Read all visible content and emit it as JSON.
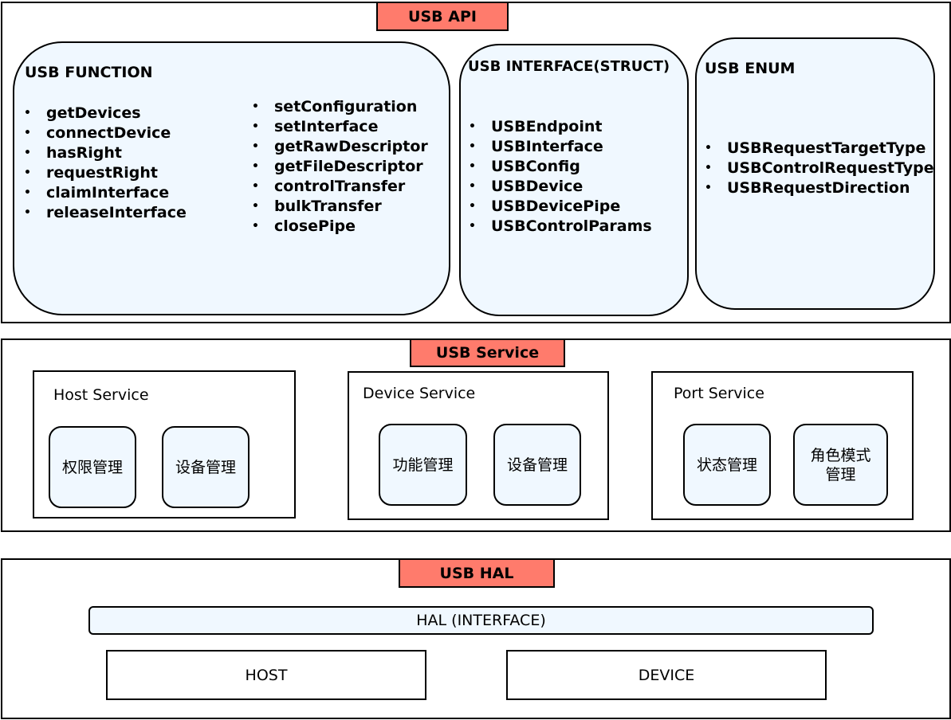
{
  "api": {
    "label": "USB API",
    "function": {
      "title": "USB FUNCTION",
      "col1": [
        "getDevices",
        "connectDevice",
        "hasRight",
        "requestRight",
        "claimInterface",
        "releaseInterface"
      ],
      "col2": [
        "setConfiguration",
        "setInterface",
        "getRawDescriptor",
        "getFileDescriptor",
        "controlTransfer",
        "bulkTransfer",
        "closePipe"
      ]
    },
    "interface": {
      "title": "USB INTERFACE(STRUCT)",
      "items": [
        "USBEndpoint",
        "USBInterface",
        "USBConfig",
        "USBDevice",
        "USBDevicePipe",
        "USBControlParams"
      ]
    },
    "enum": {
      "title": "USB ENUM",
      "items": [
        "USBRequestTargetType",
        "USBControlRequestType",
        "USBRequestDirection"
      ]
    }
  },
  "service": {
    "label": "USB Service",
    "host": {
      "title": "Host Service",
      "items": [
        "权限管理",
        "设备管理"
      ]
    },
    "device": {
      "title": "Device Service",
      "items": [
        "功能管理",
        "设备管理"
      ]
    },
    "port": {
      "title": "Port Service",
      "items": [
        "状态管理",
        "角色模式\n管理"
      ]
    }
  },
  "hal": {
    "label": "USB HAL",
    "interface": "HAL (INTERFACE)",
    "host": "HOST",
    "device": "DEVICE"
  },
  "colors": {
    "tag": "#FF7B6C",
    "panel": "#F0F8FF"
  }
}
